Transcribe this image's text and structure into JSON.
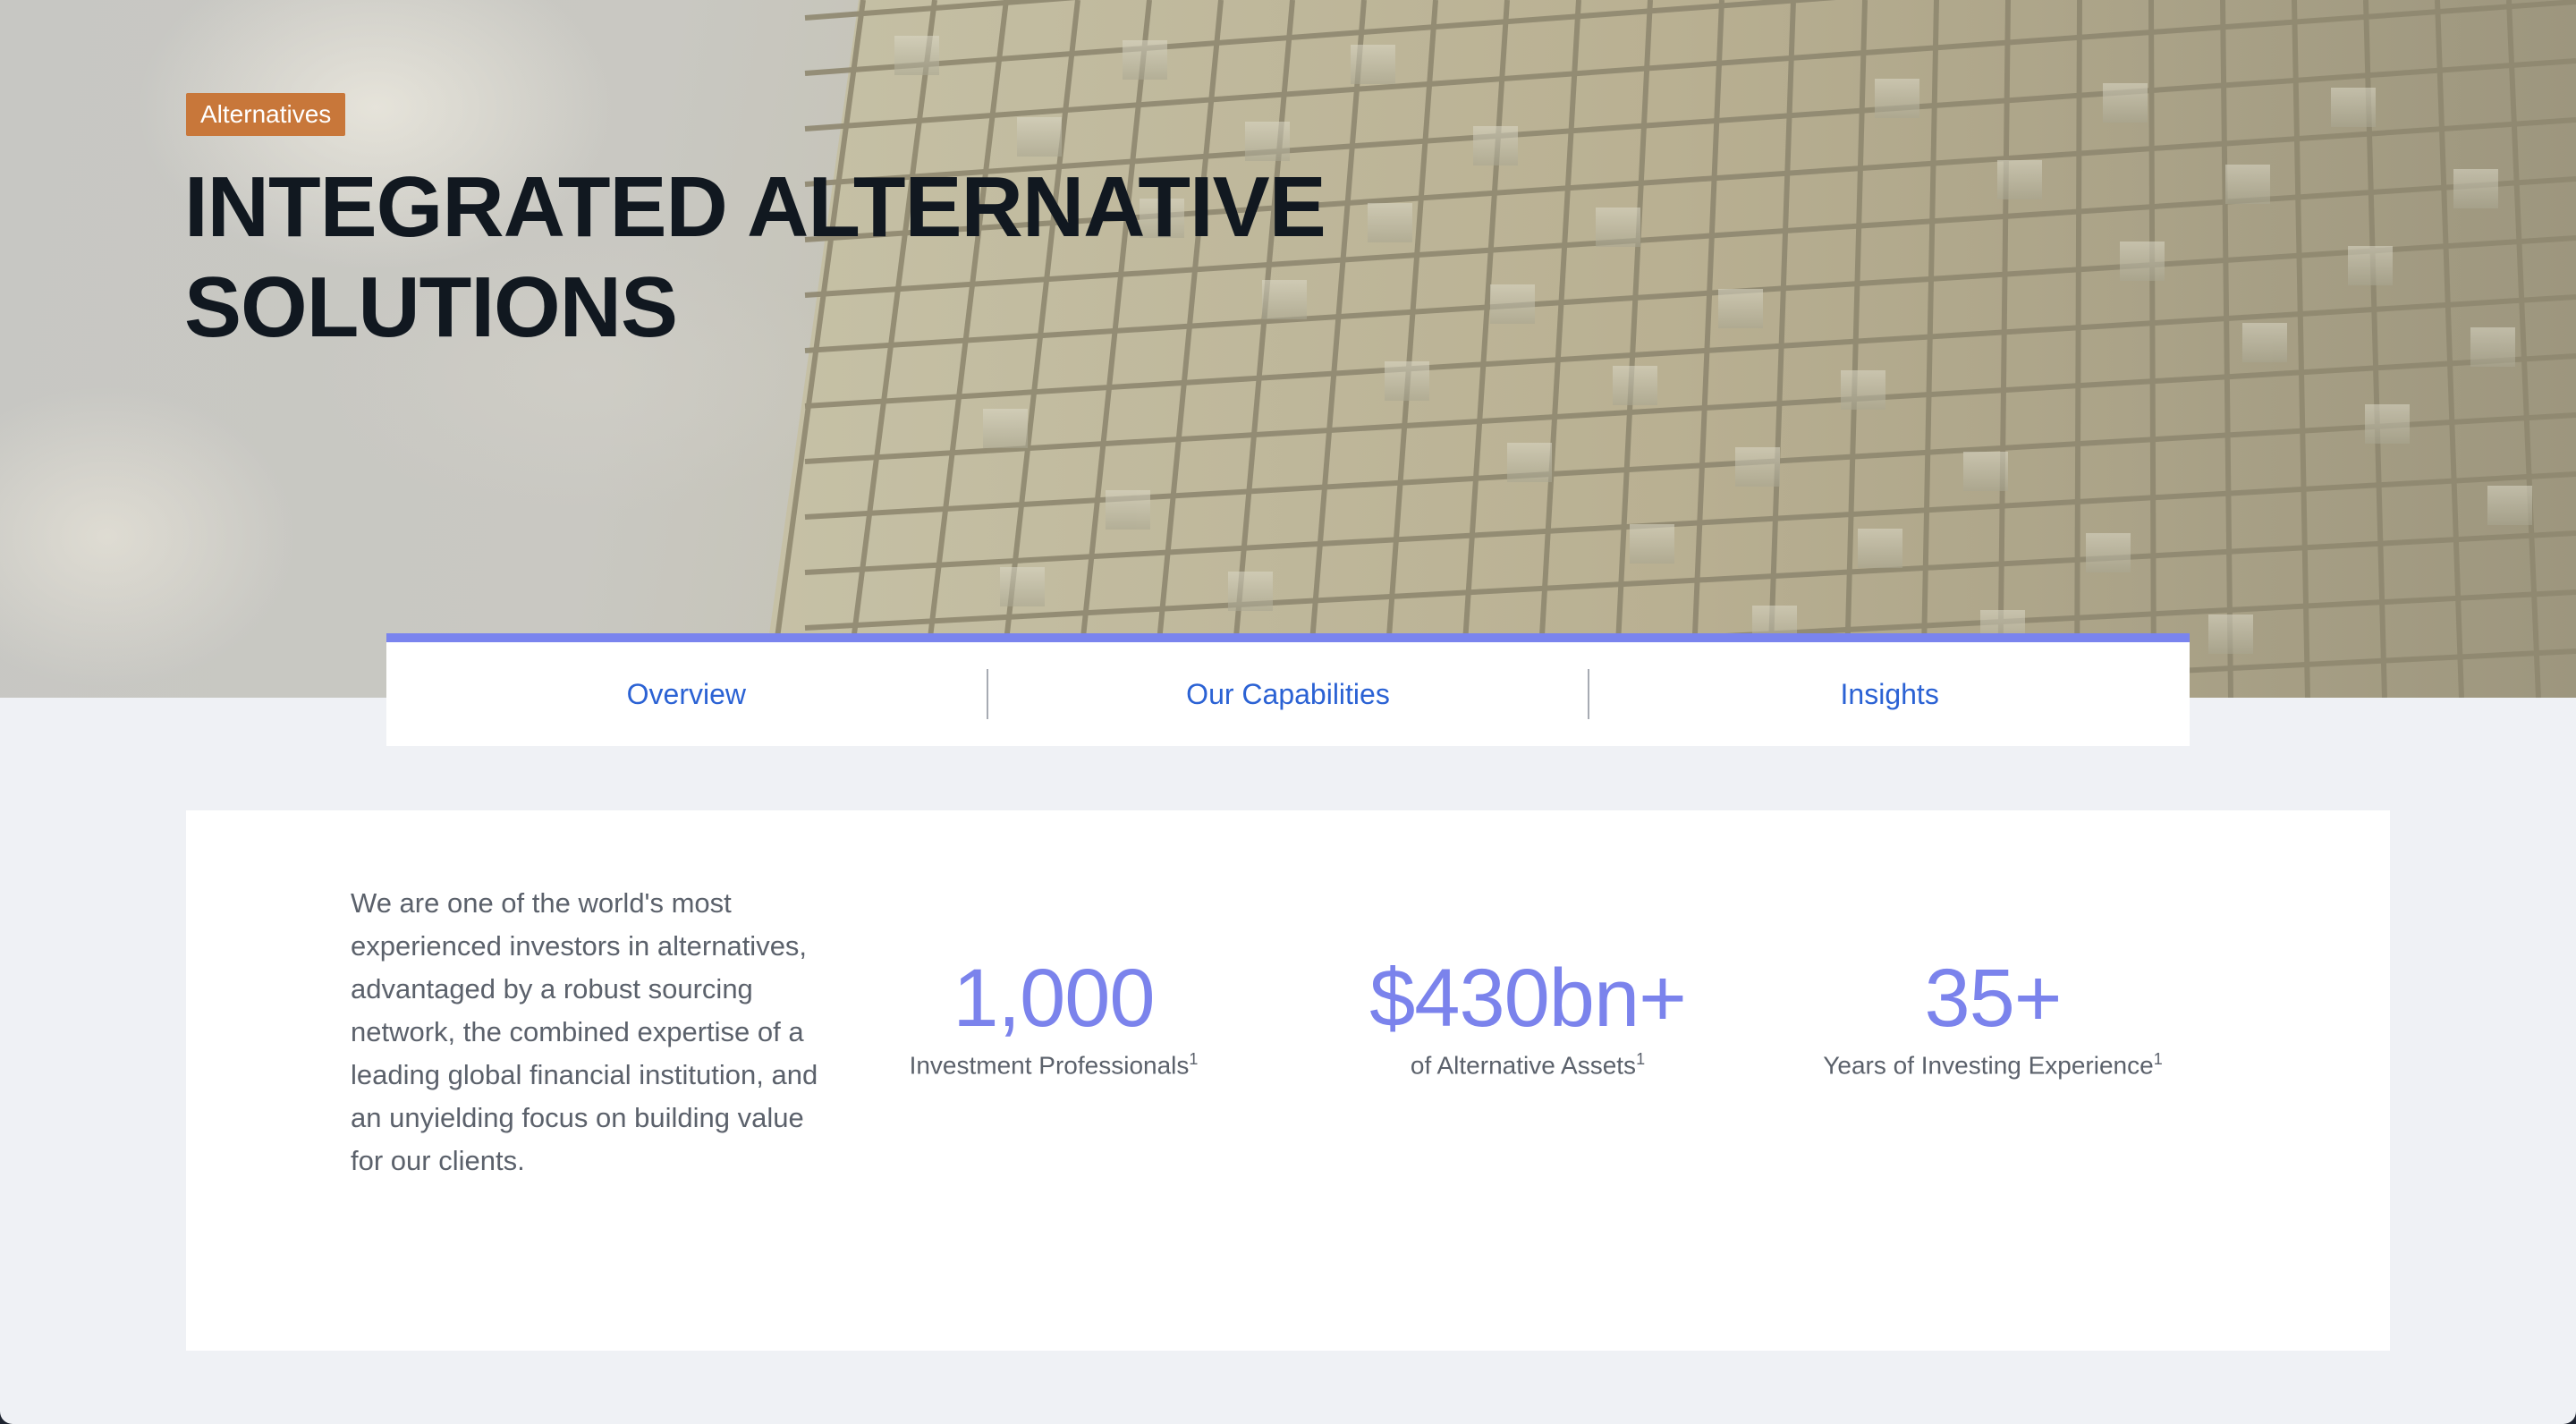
{
  "hero": {
    "badge": "Alternatives",
    "title": "INTEGRATED ALTERNATIVE SOLUTIONS",
    "background_icon": "building-facade-photo"
  },
  "tabs": [
    {
      "label": "Overview"
    },
    {
      "label": "Our Capabilities"
    },
    {
      "label": "Insights"
    }
  ],
  "intro": {
    "text": "We are one of the world's most experienced investors in alternatives, advantaged by a robust sourcing network, the combined expertise of a leading global financial institution, and an unyielding focus on building value for our clients."
  },
  "stats": [
    {
      "value": "1,000",
      "label": "Investment Professionals",
      "footnote": "1"
    },
    {
      "value": "$430bn+",
      "label": "of Alternative Assets",
      "footnote": "1"
    },
    {
      "value": "35+",
      "label": "Years of Investing Experience",
      "footnote": "1"
    }
  ],
  "colors": {
    "accent": "#7b83ec",
    "link": "#2b62d4",
    "badge": "#c8773a",
    "background": "#eff1f5"
  }
}
